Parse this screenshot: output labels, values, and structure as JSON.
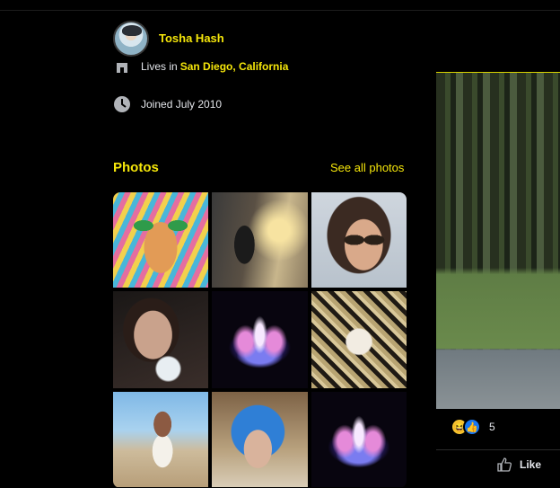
{
  "profile": {
    "name": "Tosha Hash",
    "lives_prefix": "Lives in",
    "lives_location": "San Diego, California",
    "joined": "Joined July 2010"
  },
  "photos": {
    "title": "Photos",
    "see_all": "See all photos",
    "items": [
      {
        "icon": "illustrated-face-photo"
      },
      {
        "icon": "deity-artwork-photo"
      },
      {
        "icon": "woman-sunglasses-photo"
      },
      {
        "icon": "woman-crystal-ball-photo"
      },
      {
        "icon": "neon-lotus-photo"
      },
      {
        "icon": "mandala-artwork-photo"
      },
      {
        "icon": "beach-photo"
      },
      {
        "icon": "blue-hair-photo"
      },
      {
        "icon": "neon-lotus-photo"
      }
    ]
  },
  "post": {
    "reaction_count": "5",
    "like_label": "Like"
  },
  "colors": {
    "accent": "#f5e60a",
    "background": "#000000",
    "text": "#e4e6eb"
  }
}
